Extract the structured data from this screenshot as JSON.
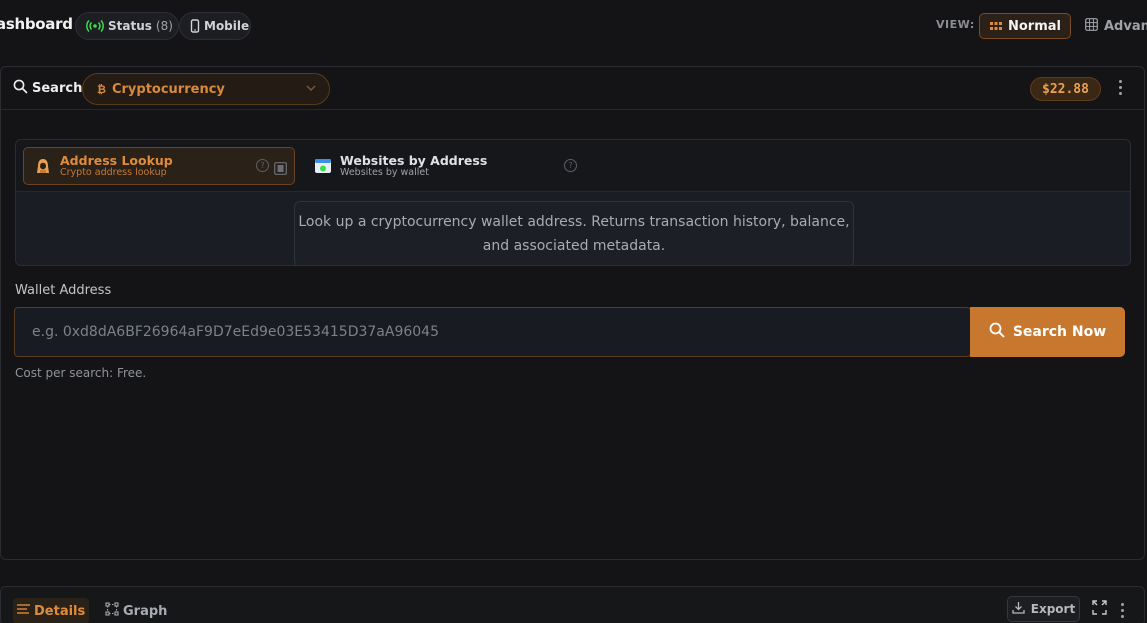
{
  "topbar": {
    "title": "ashboard",
    "status_label": "Status",
    "status_count": "(8)",
    "mobile_label": "Mobile",
    "view_label": "VIEW:",
    "view_normal": "Normal",
    "view_advanced": "Advan"
  },
  "search_panel": {
    "search_label": "Search",
    "category_selected": "Cryptocurrency",
    "price": "$22.88"
  },
  "tools": [
    {
      "title": "Address Lookup",
      "subtitle": "Crypto address lookup",
      "active": true,
      "icon": "hacker-icon"
    },
    {
      "title": "Websites by Address",
      "subtitle": "Websites by wallet",
      "active": false,
      "icon": "website-icon"
    }
  ],
  "description": "Look up a cryptocurrency wallet address. Returns transaction history, balance, and associated metadata.",
  "form": {
    "field_label": "Wallet Address",
    "placeholder": "e.g. 0xd8dA6BF26964aF9D7eEd9e03E53415D37aA96045",
    "value": "",
    "button_label": "Search Now",
    "cost_text": "Cost per search: Free."
  },
  "results": {
    "tab_details": "Details",
    "tab_graph": "Graph",
    "export_label": "Export"
  },
  "colors": {
    "accent": "#c8772f",
    "background": "#141416",
    "status_green": "#3ddc4a"
  }
}
